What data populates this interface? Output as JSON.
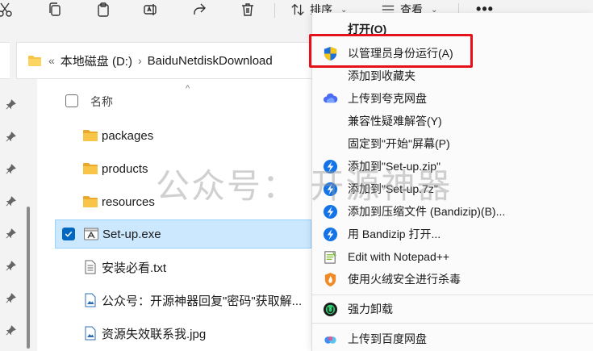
{
  "toolbar": {
    "sort_label": "排序",
    "view_label": "查看",
    "more_label": "•••",
    "icons": [
      "cut-icon",
      "copy-icon",
      "paste-icon",
      "rename-icon",
      "share-icon",
      "delete-icon",
      "sort-icon",
      "view-icon",
      "more-icon"
    ]
  },
  "address": {
    "lead_sep": "«",
    "crumbs": [
      "本地磁盘 (D:)",
      "BaiduNetdiskDownload"
    ],
    "sep": "›"
  },
  "file_list": {
    "header": {
      "name_label": "名称",
      "sort_arrow": "^"
    },
    "rows": [
      {
        "name": "packages",
        "type": "folder",
        "selected": false
      },
      {
        "name": "products",
        "type": "folder",
        "selected": false
      },
      {
        "name": "resources",
        "type": "folder",
        "selected": false
      },
      {
        "name": "Set-up.exe",
        "type": "exe",
        "selected": true
      },
      {
        "name": "安装必看.txt",
        "type": "txt",
        "selected": false
      },
      {
        "name": "公众号：开源神器回复\"密码\"获取解...",
        "type": "image",
        "selected": false
      },
      {
        "name": "资源失效联系我.jpg",
        "type": "image",
        "selected": false
      }
    ]
  },
  "watermark": {
    "text": "公众号： 开源神器"
  },
  "context_menu": {
    "items": [
      {
        "label": "打开(O)",
        "icon": "",
        "bold": true
      },
      {
        "label": "以管理员身份运行(A)",
        "icon": "uac-shield-icon",
        "bold": false
      },
      {
        "label": "添加到收藏夹",
        "icon": "",
        "bold": false
      },
      {
        "label": "上传到夸克网盘",
        "icon": "quark-cloud-icon",
        "bold": false
      },
      {
        "label": "兼容性疑难解答(Y)",
        "icon": "",
        "bold": false
      },
      {
        "label": "固定到\"开始\"屏幕(P)",
        "icon": "",
        "bold": false
      },
      {
        "label": "添加到\"Set-up.zip\"",
        "icon": "bandizip-icon",
        "bold": false
      },
      {
        "label": "添加到\"Set-up.7z\"",
        "icon": "bandizip-icon",
        "bold": false
      },
      {
        "label": "添加到压缩文件 (Bandizip)(B)...",
        "icon": "bandizip-icon",
        "bold": false
      },
      {
        "label": "用 Bandizip 打开...",
        "icon": "bandizip-icon",
        "bold": false
      },
      {
        "label": "Edit with Notepad++",
        "icon": "notepadpp-icon",
        "bold": false
      },
      {
        "label": "使用火绒安全进行杀毒",
        "icon": "huorong-icon",
        "bold": false
      },
      {
        "label": "强力卸载",
        "icon": "uninstall-icon",
        "bold": false
      },
      {
        "label": "上传到百度网盘",
        "icon": "baidu-cloud-icon",
        "bold": false
      }
    ]
  },
  "colors": {
    "accent": "#0067c0",
    "selection_bg": "#cce8ff",
    "highlight_box": "#e5121c",
    "bandizip_blue": "#1473e6",
    "folder_yellow": "#f8c546"
  }
}
